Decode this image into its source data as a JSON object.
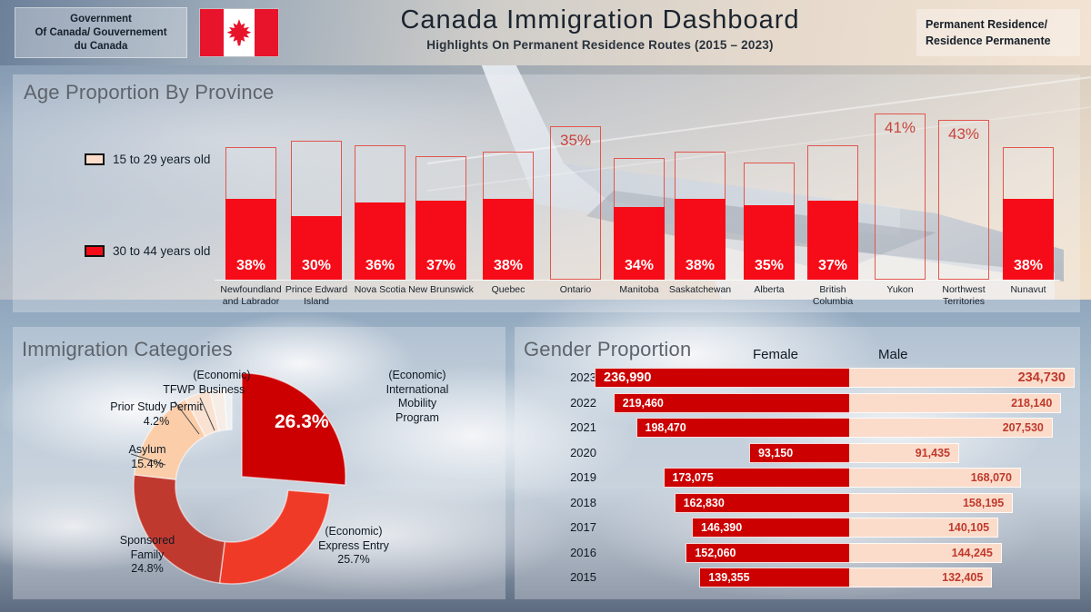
{
  "header": {
    "gov_line1": "Government",
    "gov_line2": "Of  Canada/ Gouvernement",
    "gov_line3": "du Canada",
    "flag_icon": "canada-flag-maple-leaf",
    "title": "Canada  Immigration  Dashboard",
    "subtitle": "Highlights On Permanent Residence Routes  (2015 – 2023)",
    "pr_line1": "Permanent Residence/",
    "pr_line2": "Residence Permanente"
  },
  "age_panel": {
    "title": "Age Proportion By Province",
    "legend": [
      {
        "label": "15 to 29 years old",
        "color": "#FBDCCB"
      },
      {
        "label": "30 to 44 years old",
        "color": "#F60C18"
      }
    ]
  },
  "categories_panel": {
    "title": "Immigration Categories"
  },
  "gender_panel": {
    "title": "Gender Proportion",
    "col_female": "Female",
    "col_male": "Male"
  },
  "chart_data": [
    {
      "type": "bar",
      "id": "age-proportion-by-province",
      "title": "Age Proportion By Province",
      "xlabel": "",
      "ylabel": "",
      "ylim": [
        0,
        100
      ],
      "legend": [
        "15 to 29 years old",
        "30 to 44 years old"
      ],
      "categories": [
        "Newfoundland and Labrador",
        "Prince Edward Island",
        "Nova Scotia",
        "New Brunswick",
        "Quebec",
        "Ontario",
        "Manitoba",
        "Saskatchewan",
        "Alberta",
        "British Columbia",
        "Yukon",
        "Northwest Territories",
        "Nunavut"
      ],
      "bars": [
        {
          "province": "Newfoundland and Labrador",
          "label": "38%",
          "value": 38,
          "total": 62,
          "filled": true
        },
        {
          "province": "Prince Edward Island",
          "label": "30%",
          "value": 30,
          "total": 65,
          "filled": true
        },
        {
          "province": "Nova Scotia",
          "label": "36%",
          "value": 36,
          "total": 63,
          "filled": true
        },
        {
          "province": "New Brunswick",
          "label": "37%",
          "value": 37,
          "total": 58,
          "filled": true
        },
        {
          "province": "Quebec",
          "label": "38%",
          "value": 38,
          "total": 60,
          "filled": true
        },
        {
          "province": "Ontario",
          "label": "35%",
          "value": 35,
          "total": 72,
          "filled": false
        },
        {
          "province": "Manitoba",
          "label": "34%",
          "value": 34,
          "total": 57,
          "filled": true
        },
        {
          "province": "Saskatchewan",
          "label": "38%",
          "value": 38,
          "total": 60,
          "filled": true
        },
        {
          "province": "Alberta",
          "label": "35%",
          "value": 35,
          "total": 55,
          "filled": true
        },
        {
          "province": "British Columbia",
          "label": "37%",
          "value": 37,
          "total": 63,
          "filled": true
        },
        {
          "province": "Yukon",
          "label": "41%",
          "value": 41,
          "total": 78,
          "filled": false
        },
        {
          "province": "Northwest Territories",
          "label": "43%",
          "value": 43,
          "total": 75,
          "filled": false
        },
        {
          "province": "Nunavut",
          "label": "38%",
          "value": 38,
          "total": 62,
          "filled": true
        }
      ]
    },
    {
      "type": "pie",
      "id": "immigration-categories",
      "title": "Immigration Categories",
      "donut": true,
      "highlight": "(Economic) International Mobility Program",
      "highlight_value": "26.3%",
      "slices": [
        {
          "label": "(Economic)\nInternational\nMobility\nProgram",
          "short": "International Mobility Program",
          "value": 26.3,
          "display": "26.3%",
          "color": "#CC0000",
          "exploded": true
        },
        {
          "label": "(Economic)\nExpress Entry",
          "short": "Express Entry",
          "value": 25.7,
          "display": "25.7%",
          "color": "#F03A28",
          "exploded": false
        },
        {
          "label": "Sponsored\nFamily",
          "short": "Sponsored Family",
          "value": 24.8,
          "display": "24.8%",
          "color": "#C0392F",
          "exploded": false
        },
        {
          "label": "Asylum",
          "short": "Asylum",
          "value": 15.4,
          "display": "15.4%",
          "color": "#FBCDA9",
          "exploded": false
        },
        {
          "label": "Prior Study Permit",
          "short": "Prior Study Permit",
          "value": 4.2,
          "display": "4.2%",
          "color": "#FAE2D2",
          "exploded": false
        },
        {
          "label": "TFWP",
          "short": "TFWP",
          "value": 2.3,
          "display": "",
          "color": "#F6EDE7",
          "exploded": false
        },
        {
          "label": "(Economic) Business",
          "short": "Business",
          "value": 1.3,
          "display": "",
          "color": "#EFF1F2",
          "exploded": false
        }
      ],
      "annotations": {
        "imp": "(Economic)\nInternational\nMobility\nProgram",
        "imp_l1": "(Economic)",
        "imp_l2": "International",
        "imp_l3": "Mobility",
        "imp_l4": "Program",
        "ee_l1": "(Economic)",
        "ee_l2": "Express Entry",
        "ee_l3": "25.7%",
        "sf_l1": "Sponsored",
        "sf_l2": "Family",
        "sf_l3": "24.8%",
        "as_l1": "Asylum",
        "as_l2": "15.4%",
        "ps_l1": "Prior Study Permit",
        "ps_l2": "4.2%",
        "tfwp": "TFWP",
        "biz_l1": "(Economic)",
        "biz_l2": "Business"
      }
    },
    {
      "type": "bar",
      "id": "gender-proportion",
      "title": "Gender Proportion",
      "orientation": "horizontal-diverging",
      "series": [
        {
          "name": "Female",
          "values": [
            236990,
            219460,
            198470,
            93150,
            173075,
            162830,
            146390,
            152060,
            139355
          ]
        },
        {
          "name": "Male",
          "values": [
            234730,
            218140,
            207530,
            91435,
            168070,
            158195,
            140105,
            144245,
            132405
          ]
        }
      ],
      "categories": [
        "2023",
        "2022",
        "2021",
        "2020",
        "2019",
        "2018",
        "2017",
        "2016",
        "2015"
      ],
      "rows": [
        {
          "year": "2023",
          "female": "236,990",
          "male": "234,730",
          "female_val": 236990,
          "male_val": 234730
        },
        {
          "year": "2022",
          "female": "219,460",
          "male": "218,140",
          "female_val": 219460,
          "male_val": 218140
        },
        {
          "year": "2021",
          "female": "198,470",
          "male": "207,530",
          "female_val": 198470,
          "male_val": 207530
        },
        {
          "year": "2020",
          "female": "93,150",
          "male": "91,435",
          "female_val": 93150,
          "male_val": 91435
        },
        {
          "year": "2019",
          "female": "173,075",
          "male": "168,070",
          "female_val": 173075,
          "male_val": 168070
        },
        {
          "year": "2018",
          "female": "162,830",
          "male": "158,195",
          "female_val": 162830,
          "male_val": 158195
        },
        {
          "year": "2017",
          "female": "146,390",
          "male": "140,105",
          "female_val": 146390,
          "male_val": 140105
        },
        {
          "year": "2016",
          "female": "152,060",
          "male": "144,245",
          "female_val": 152060,
          "male_val": 144245
        },
        {
          "year": "2015",
          "female": "139,355",
          "male": "132,405",
          "female_val": 139355,
          "male_val": 132405
        }
      ],
      "colors": {
        "female": "#CC0000",
        "male": "#FBDCCB",
        "male_text": "#C0392B"
      }
    }
  ]
}
